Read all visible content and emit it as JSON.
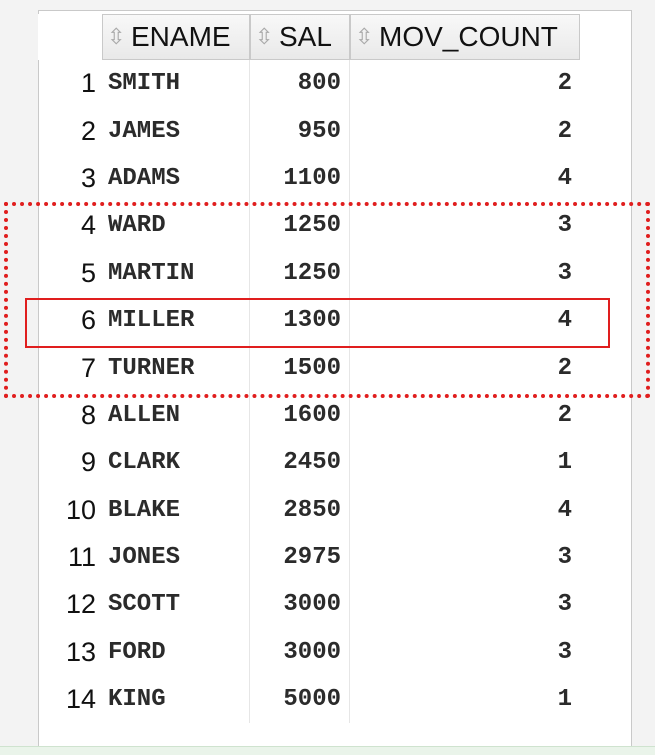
{
  "grid": {
    "columns": [
      "ENAME",
      "SAL",
      "MOV_COUNT"
    ],
    "sort_icon": "sort-updown-icon",
    "rows": [
      {
        "num": "1",
        "ename": "SMITH",
        "sal": "800",
        "mov_count": "2"
      },
      {
        "num": "2",
        "ename": "JAMES",
        "sal": "950",
        "mov_count": "2"
      },
      {
        "num": "3",
        "ename": "ADAMS",
        "sal": "1100",
        "mov_count": "4"
      },
      {
        "num": "4",
        "ename": "WARD",
        "sal": "1250",
        "mov_count": "3"
      },
      {
        "num": "5",
        "ename": "MARTIN",
        "sal": "1250",
        "mov_count": "3"
      },
      {
        "num": "6",
        "ename": "MILLER",
        "sal": "1300",
        "mov_count": "4"
      },
      {
        "num": "7",
        "ename": "TURNER",
        "sal": "1500",
        "mov_count": "2"
      },
      {
        "num": "8",
        "ename": "ALLEN",
        "sal": "1600",
        "mov_count": "2"
      },
      {
        "num": "9",
        "ename": "CLARK",
        "sal": "2450",
        "mov_count": "1"
      },
      {
        "num": "10",
        "ename": "BLAKE",
        "sal": "2850",
        "mov_count": "4"
      },
      {
        "num": "11",
        "ename": "JONES",
        "sal": "2975",
        "mov_count": "3"
      },
      {
        "num": "12",
        "ename": "SCOTT",
        "sal": "3000",
        "mov_count": "3"
      },
      {
        "num": "13",
        "ename": "FORD",
        "sal": "3000",
        "mov_count": "3"
      },
      {
        "num": "14",
        "ename": "KING",
        "sal": "5000",
        "mov_count": "1"
      }
    ]
  },
  "annotations": {
    "highlight_color": "#e01e1e"
  }
}
